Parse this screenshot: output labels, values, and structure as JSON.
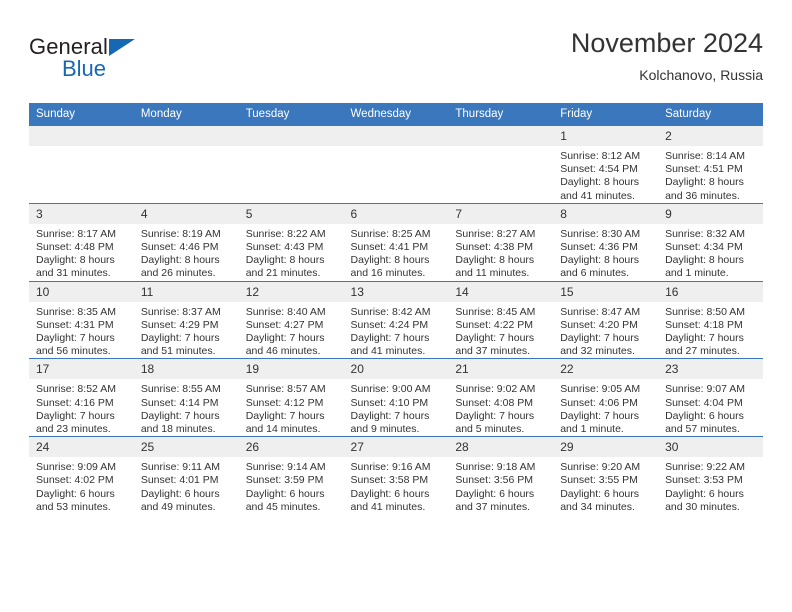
{
  "brand": {
    "name_part1": "General",
    "name_part2": "Blue"
  },
  "header": {
    "title": "November 2024",
    "location": "Kolchanovo, Russia"
  },
  "colors": {
    "header_blue": "#3b77bd",
    "brand_blue": "#1668b3",
    "daynum_background": "#efefef",
    "text": "#333333"
  },
  "weekdays": [
    "Sunday",
    "Monday",
    "Tuesday",
    "Wednesday",
    "Thursday",
    "Friday",
    "Saturday"
  ],
  "weeks": [
    [
      {
        "day": "",
        "empty": true
      },
      {
        "day": "",
        "empty": true
      },
      {
        "day": "",
        "empty": true
      },
      {
        "day": "",
        "empty": true
      },
      {
        "day": "",
        "empty": true
      },
      {
        "day": "1",
        "sunrise": "Sunrise: 8:12 AM",
        "sunset": "Sunset: 4:54 PM",
        "daylight1": "Daylight: 8 hours",
        "daylight2": "and 41 minutes."
      },
      {
        "day": "2",
        "sunrise": "Sunrise: 8:14 AM",
        "sunset": "Sunset: 4:51 PM",
        "daylight1": "Daylight: 8 hours",
        "daylight2": "and 36 minutes."
      }
    ],
    [
      {
        "day": "3",
        "sunrise": "Sunrise: 8:17 AM",
        "sunset": "Sunset: 4:48 PM",
        "daylight1": "Daylight: 8 hours",
        "daylight2": "and 31 minutes."
      },
      {
        "day": "4",
        "sunrise": "Sunrise: 8:19 AM",
        "sunset": "Sunset: 4:46 PM",
        "daylight1": "Daylight: 8 hours",
        "daylight2": "and 26 minutes."
      },
      {
        "day": "5",
        "sunrise": "Sunrise: 8:22 AM",
        "sunset": "Sunset: 4:43 PM",
        "daylight1": "Daylight: 8 hours",
        "daylight2": "and 21 minutes."
      },
      {
        "day": "6",
        "sunrise": "Sunrise: 8:25 AM",
        "sunset": "Sunset: 4:41 PM",
        "daylight1": "Daylight: 8 hours",
        "daylight2": "and 16 minutes."
      },
      {
        "day": "7",
        "sunrise": "Sunrise: 8:27 AM",
        "sunset": "Sunset: 4:38 PM",
        "daylight1": "Daylight: 8 hours",
        "daylight2": "and 11 minutes."
      },
      {
        "day": "8",
        "sunrise": "Sunrise: 8:30 AM",
        "sunset": "Sunset: 4:36 PM",
        "daylight1": "Daylight: 8 hours",
        "daylight2": "and 6 minutes."
      },
      {
        "day": "9",
        "sunrise": "Sunrise: 8:32 AM",
        "sunset": "Sunset: 4:34 PM",
        "daylight1": "Daylight: 8 hours",
        "daylight2": "and 1 minute."
      }
    ],
    [
      {
        "day": "10",
        "sunrise": "Sunrise: 8:35 AM",
        "sunset": "Sunset: 4:31 PM",
        "daylight1": "Daylight: 7 hours",
        "daylight2": "and 56 minutes."
      },
      {
        "day": "11",
        "sunrise": "Sunrise: 8:37 AM",
        "sunset": "Sunset: 4:29 PM",
        "daylight1": "Daylight: 7 hours",
        "daylight2": "and 51 minutes."
      },
      {
        "day": "12",
        "sunrise": "Sunrise: 8:40 AM",
        "sunset": "Sunset: 4:27 PM",
        "daylight1": "Daylight: 7 hours",
        "daylight2": "and 46 minutes."
      },
      {
        "day": "13",
        "sunrise": "Sunrise: 8:42 AM",
        "sunset": "Sunset: 4:24 PM",
        "daylight1": "Daylight: 7 hours",
        "daylight2": "and 41 minutes."
      },
      {
        "day": "14",
        "sunrise": "Sunrise: 8:45 AM",
        "sunset": "Sunset: 4:22 PM",
        "daylight1": "Daylight: 7 hours",
        "daylight2": "and 37 minutes."
      },
      {
        "day": "15",
        "sunrise": "Sunrise: 8:47 AM",
        "sunset": "Sunset: 4:20 PM",
        "daylight1": "Daylight: 7 hours",
        "daylight2": "and 32 minutes."
      },
      {
        "day": "16",
        "sunrise": "Sunrise: 8:50 AM",
        "sunset": "Sunset: 4:18 PM",
        "daylight1": "Daylight: 7 hours",
        "daylight2": "and 27 minutes."
      }
    ],
    [
      {
        "day": "17",
        "sunrise": "Sunrise: 8:52 AM",
        "sunset": "Sunset: 4:16 PM",
        "daylight1": "Daylight: 7 hours",
        "daylight2": "and 23 minutes."
      },
      {
        "day": "18",
        "sunrise": "Sunrise: 8:55 AM",
        "sunset": "Sunset: 4:14 PM",
        "daylight1": "Daylight: 7 hours",
        "daylight2": "and 18 minutes."
      },
      {
        "day": "19",
        "sunrise": "Sunrise: 8:57 AM",
        "sunset": "Sunset: 4:12 PM",
        "daylight1": "Daylight: 7 hours",
        "daylight2": "and 14 minutes."
      },
      {
        "day": "20",
        "sunrise": "Sunrise: 9:00 AM",
        "sunset": "Sunset: 4:10 PM",
        "daylight1": "Daylight: 7 hours",
        "daylight2": "and 9 minutes."
      },
      {
        "day": "21",
        "sunrise": "Sunrise: 9:02 AM",
        "sunset": "Sunset: 4:08 PM",
        "daylight1": "Daylight: 7 hours",
        "daylight2": "and 5 minutes."
      },
      {
        "day": "22",
        "sunrise": "Sunrise: 9:05 AM",
        "sunset": "Sunset: 4:06 PM",
        "daylight1": "Daylight: 7 hours",
        "daylight2": "and 1 minute."
      },
      {
        "day": "23",
        "sunrise": "Sunrise: 9:07 AM",
        "sunset": "Sunset: 4:04 PM",
        "daylight1": "Daylight: 6 hours",
        "daylight2": "and 57 minutes."
      }
    ],
    [
      {
        "day": "24",
        "sunrise": "Sunrise: 9:09 AM",
        "sunset": "Sunset: 4:02 PM",
        "daylight1": "Daylight: 6 hours",
        "daylight2": "and 53 minutes."
      },
      {
        "day": "25",
        "sunrise": "Sunrise: 9:11 AM",
        "sunset": "Sunset: 4:01 PM",
        "daylight1": "Daylight: 6 hours",
        "daylight2": "and 49 minutes."
      },
      {
        "day": "26",
        "sunrise": "Sunrise: 9:14 AM",
        "sunset": "Sunset: 3:59 PM",
        "daylight1": "Daylight: 6 hours",
        "daylight2": "and 45 minutes."
      },
      {
        "day": "27",
        "sunrise": "Sunrise: 9:16 AM",
        "sunset": "Sunset: 3:58 PM",
        "daylight1": "Daylight: 6 hours",
        "daylight2": "and 41 minutes."
      },
      {
        "day": "28",
        "sunrise": "Sunrise: 9:18 AM",
        "sunset": "Sunset: 3:56 PM",
        "daylight1": "Daylight: 6 hours",
        "daylight2": "and 37 minutes."
      },
      {
        "day": "29",
        "sunrise": "Sunrise: 9:20 AM",
        "sunset": "Sunset: 3:55 PM",
        "daylight1": "Daylight: 6 hours",
        "daylight2": "and 34 minutes."
      },
      {
        "day": "30",
        "sunrise": "Sunrise: 9:22 AM",
        "sunset": "Sunset: 3:53 PM",
        "daylight1": "Daylight: 6 hours",
        "daylight2": "and 30 minutes."
      }
    ]
  ]
}
